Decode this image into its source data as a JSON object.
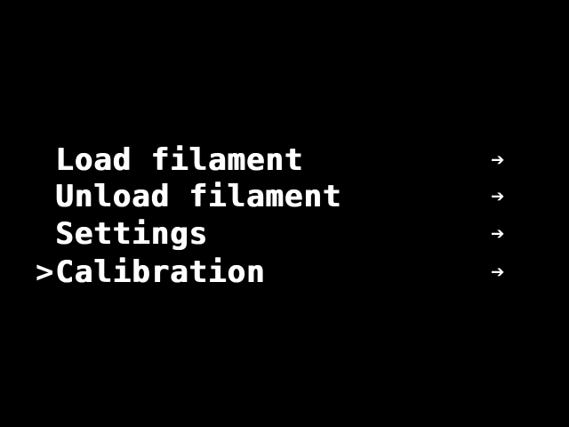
{
  "menu": {
    "items": [
      {
        "label": "Load filament",
        "arrow": "➔",
        "cursor": ""
      },
      {
        "label": "Unload filament",
        "arrow": "➔",
        "cursor": ""
      },
      {
        "label": "Settings",
        "arrow": "➔",
        "cursor": ""
      },
      {
        "label": "Calibration",
        "arrow": "➔",
        "cursor": ">"
      }
    ]
  },
  "colors": {
    "background": "#000000",
    "foreground": "#ffffff"
  }
}
